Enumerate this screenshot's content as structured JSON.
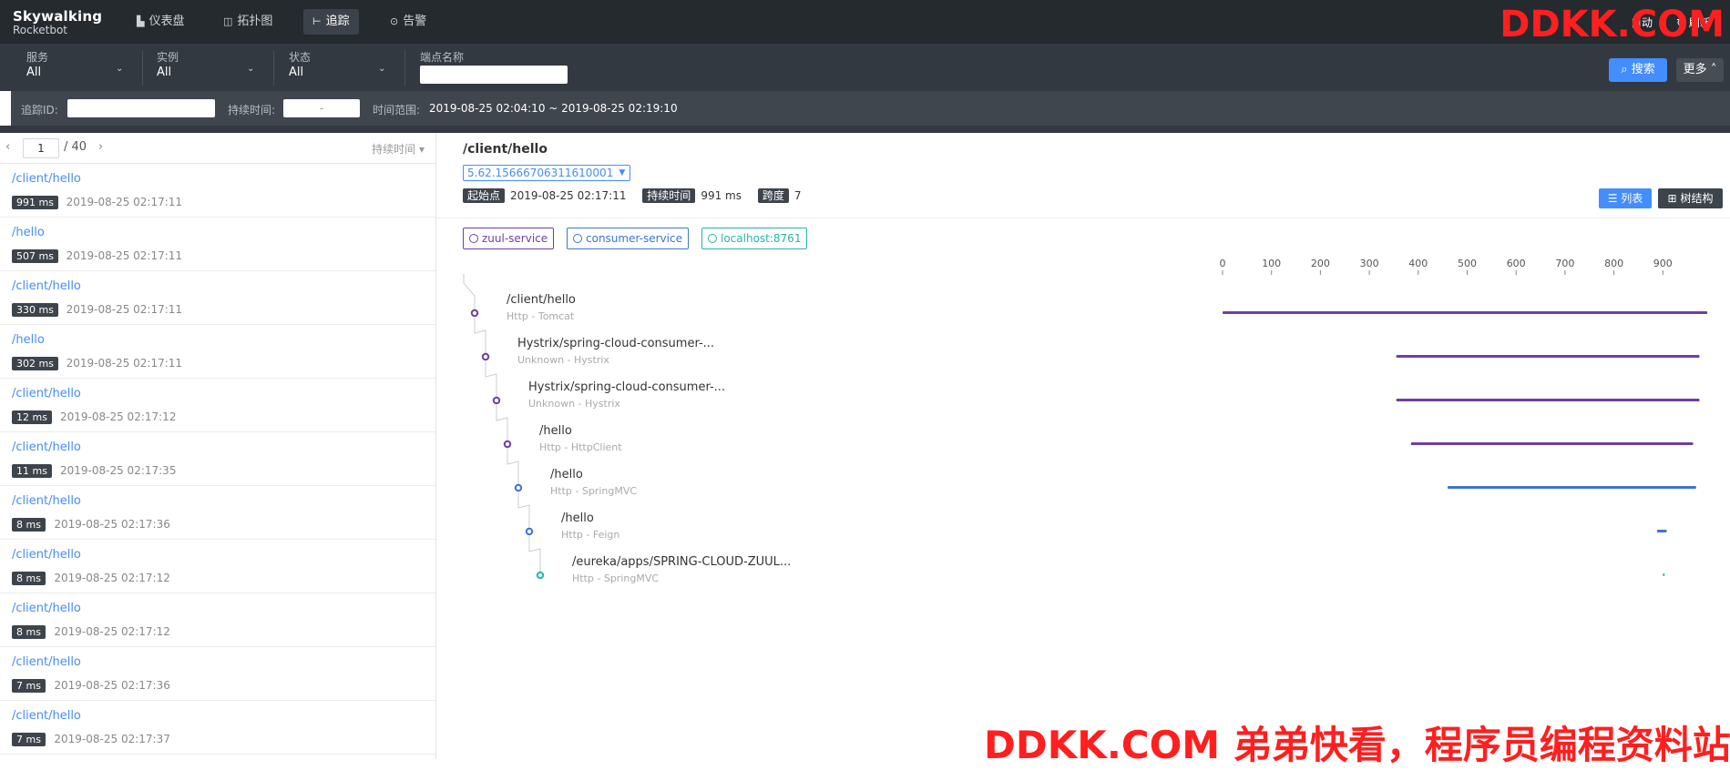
{
  "nav": {
    "logo_top": "Skywalking",
    "logo_bottom": "Rocketbot",
    "items": [
      {
        "label": "仪表盘",
        "icon": "chart-icon"
      },
      {
        "label": "拓扑图",
        "icon": "topology-icon"
      },
      {
        "label": "追踪",
        "icon": "trace-icon"
      },
      {
        "label": "告警",
        "icon": "alarm-icon"
      }
    ],
    "right_auto": "自动",
    "right_refresh": "刷新"
  },
  "watermark": {
    "top": "DDKK.COM",
    "bottom": "DDKK.COM 弟弟快看，程序员编程资料站"
  },
  "filters": {
    "service": {
      "label": "服务",
      "value": "All"
    },
    "instance": {
      "label": "实例",
      "value": "All"
    },
    "status": {
      "label": "状态",
      "value": "All"
    },
    "endpoint": {
      "label": "端点名称",
      "value": ""
    },
    "search": "搜索",
    "more": "更多"
  },
  "filters2": {
    "trace_id_label": "追踪ID:",
    "duration_label": "持续时间:",
    "duration_sep": "-",
    "range_label": "时间范围:",
    "range_value": "2019-08-25 02:04:10 ~ 2019-08-25 02:19:10"
  },
  "pager": {
    "page": "1",
    "total": "/ 40",
    "sort": "持续时间"
  },
  "traces": [
    {
      "name": "/client/hello",
      "duration": "991 ms",
      "time": "2019-08-25 02:17:11"
    },
    {
      "name": "/hello",
      "duration": "507 ms",
      "time": "2019-08-25 02:17:11"
    },
    {
      "name": "/client/hello",
      "duration": "330 ms",
      "time": "2019-08-25 02:17:11"
    },
    {
      "name": "/hello",
      "duration": "302 ms",
      "time": "2019-08-25 02:17:11"
    },
    {
      "name": "/client/hello",
      "duration": "12 ms",
      "time": "2019-08-25 02:17:12"
    },
    {
      "name": "/client/hello",
      "duration": "11 ms",
      "time": "2019-08-25 02:17:35"
    },
    {
      "name": "/client/hello",
      "duration": "8 ms",
      "time": "2019-08-25 02:17:36"
    },
    {
      "name": "/client/hello",
      "duration": "8 ms",
      "time": "2019-08-25 02:17:12"
    },
    {
      "name": "/client/hello",
      "duration": "8 ms",
      "time": "2019-08-25 02:17:12"
    },
    {
      "name": "/client/hello",
      "duration": "7 ms",
      "time": "2019-08-25 02:17:36"
    },
    {
      "name": "/client/hello",
      "duration": "7 ms",
      "time": "2019-08-25 02:17:37"
    }
  ],
  "detail": {
    "title": "/client/hello",
    "trace_id": "5.62.15666706311610001",
    "start_label": "起始点",
    "start_value": "2019-08-25 02:17:11",
    "duration_label": "持续时间",
    "duration_value": "991 ms",
    "span_label": "跨度",
    "span_value": "7",
    "btn_list": "列表",
    "btn_tree": "树结构"
  },
  "services": [
    {
      "name": "zuul-service",
      "color": "#6f3ea3"
    },
    {
      "name": "consumer-service",
      "color": "#3d75d1"
    },
    {
      "name": "localhost:8761",
      "color": "#26b6a6"
    }
  ],
  "timeline": {
    "ticks": [
      "0",
      "100",
      "200",
      "300",
      "400",
      "500",
      "600",
      "700",
      "800",
      "900"
    ],
    "span_max_ms": 991
  },
  "spans": [
    {
      "name": "/client/hello",
      "sub": "Http - Tomcat",
      "color": "#6f3ea3",
      "start": 0,
      "end": 991
    },
    {
      "name": "Hystrix/spring-cloud-consumer-...",
      "sub": "Unknown - Hystrix",
      "color": "#6f3ea3",
      "start": 355,
      "end": 975
    },
    {
      "name": "Hystrix/spring-cloud-consumer-...",
      "sub": "Unknown - Hystrix",
      "color": "#6f3ea3",
      "start": 355,
      "end": 975
    },
    {
      "name": "/hello",
      "sub": "Http - HttpClient",
      "color": "#6f3ea3",
      "start": 385,
      "end": 962
    },
    {
      "name": "/hello",
      "sub": "Http - SpringMVC",
      "color": "#3d75d1",
      "start": 460,
      "end": 968
    },
    {
      "name": "/hello",
      "sub": "Http - Feign",
      "color": "#3d75d1",
      "start": 888,
      "end": 908
    },
    {
      "name": "/eureka/apps/SPRING-CLOUD-ZUUL...",
      "sub": "Http - SpringMVC",
      "color": "#26b6a6",
      "start": 900,
      "end": 902
    }
  ]
}
